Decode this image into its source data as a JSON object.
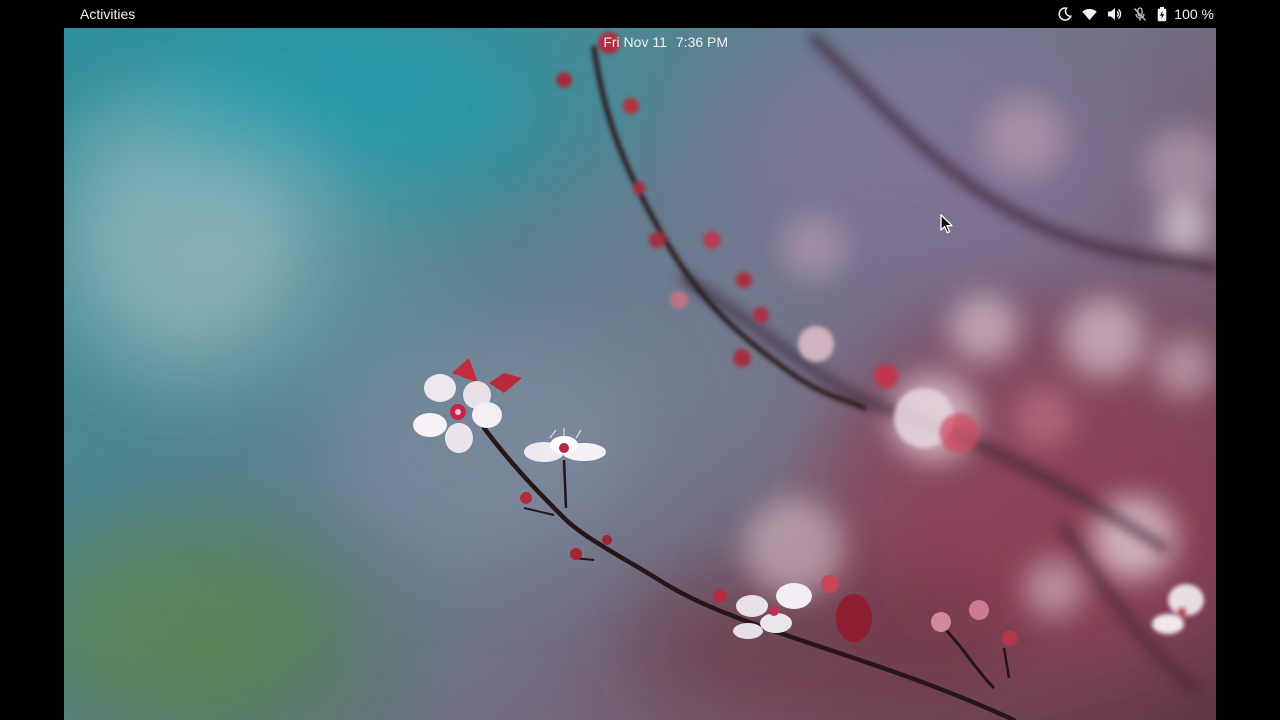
{
  "topbar": {
    "activities_label": "Activities",
    "date": "Fri Nov 11",
    "time": "7:36 PM",
    "battery_percent": "100 %"
  },
  "tray_icons": [
    "night-light-icon",
    "wifi-icon",
    "volume-icon",
    "microphone-muted-icon",
    "battery-icon"
  ],
  "colors": {
    "topbar_bg": "#000000",
    "topbar_text": "#f2f2f2",
    "blossom_petal": "#f3eef2",
    "blossom_center": "#c8234a",
    "branch": "#2a1a1e"
  }
}
